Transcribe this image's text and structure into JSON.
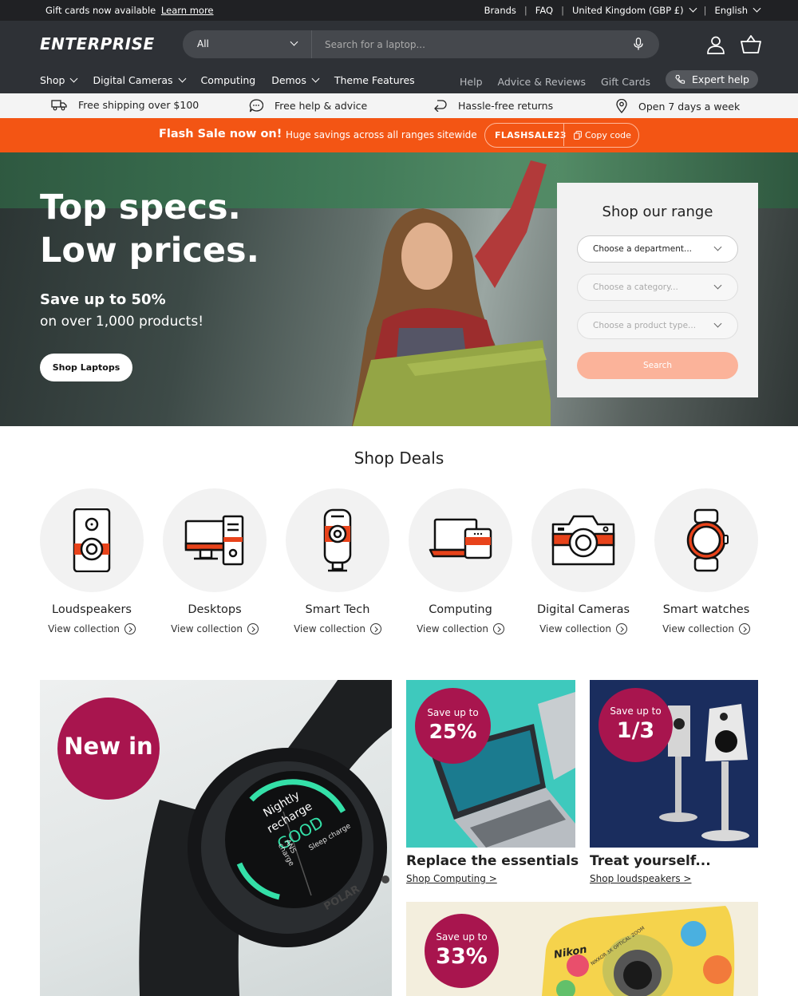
{
  "announcement": {
    "text": "Gift cards now available",
    "link": "Learn more"
  },
  "utility_nav": {
    "brands": "Brands",
    "faq": "FAQ",
    "country": "United Kingdom (GBP £)",
    "language": "English"
  },
  "header": {
    "logo": "ENTERPRISE",
    "search": {
      "department": "All",
      "placeholder": "Search for a laptop..."
    },
    "icons": [
      "microphone-icon",
      "account-icon",
      "basket-icon"
    ]
  },
  "main_nav": [
    {
      "label": "Shop",
      "dropdown": true
    },
    {
      "label": "Digital Cameras",
      "dropdown": true
    },
    {
      "label": "Computing",
      "dropdown": false
    },
    {
      "label": "Demos",
      "dropdown": true
    },
    {
      "label": "Theme Features",
      "dropdown": false
    }
  ],
  "secondary_nav": {
    "help": "Help",
    "advice": "Advice & Reviews",
    "gift": "Gift Cards",
    "expert": "Expert help"
  },
  "usp": [
    {
      "icon": "truck-icon",
      "label": "Free shipping over $100"
    },
    {
      "icon": "chat-icon",
      "label": "Free help & advice"
    },
    {
      "icon": "return-icon",
      "label": "Hassle-free returns"
    },
    {
      "icon": "location-pin-icon",
      "label": "Open 7 days a week"
    }
  ],
  "flash_sale": {
    "title": "Flash Sale now on!",
    "description": "Huge savings across all ranges sitewide",
    "code": "FLASHSALE23",
    "copy": "Copy code"
  },
  "hero": {
    "line1": "Top specs.",
    "line2": "Low prices.",
    "save": "Save up to 50%",
    "sub": "on over 1,000 products!",
    "button": "Shop Laptops"
  },
  "range": {
    "title": "Shop our range",
    "department": "Choose a department...",
    "category": "Choose a category...",
    "product_type": "Choose a product type...",
    "search": "Search"
  },
  "deals": {
    "title": "Shop Deals",
    "view_label": "View collection",
    "items": [
      {
        "name": "Loudspeakers",
        "icon": "loudspeaker-icon"
      },
      {
        "name": "Desktops",
        "icon": "desktop-icon"
      },
      {
        "name": "Smart Tech",
        "icon": "smart-speaker-icon"
      },
      {
        "name": "Computing",
        "icon": "laptop-tablet-icon"
      },
      {
        "name": "Digital Cameras",
        "icon": "camera-icon"
      },
      {
        "name": "Smart watches",
        "icon": "watch-icon"
      }
    ]
  },
  "promos": {
    "watch": {
      "badge": "New in",
      "screen_text": [
        "Nightly",
        "recharge",
        "GOOD",
        "ANS charge",
        "Sleep charge"
      ],
      "brand": "POLAR"
    },
    "laptop": {
      "badge_top": "Save up to",
      "badge_value": "25%",
      "title": "Replace the essentials",
      "link": "Shop Computing >"
    },
    "speaker": {
      "badge_top": "Save up to",
      "badge_value": "1/3",
      "title": "Treat yourself...",
      "link": "Shop loudspeakers >"
    },
    "camera": {
      "badge_top": "Save up to",
      "badge_value": "33%",
      "brand": "Nikon",
      "lens_text": "NIKKOR 3X OPTICAL ZOOM"
    }
  },
  "colors": {
    "brand_orange": "#f35514",
    "header_bg": "#2e3136",
    "badge": "#a8154e",
    "icon_accent": "#e8431b"
  }
}
